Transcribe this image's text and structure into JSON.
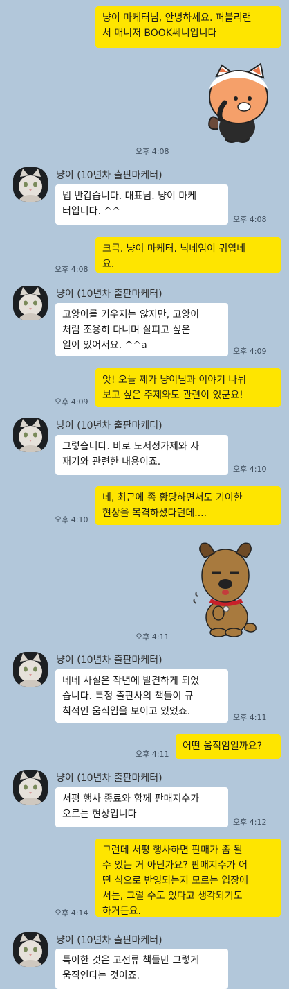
{
  "chat": {
    "sender_name": "냥이 (10년차 출판마케터)",
    "messages": [
      {
        "from": "me",
        "text": "냥이 마케터님, 안녕하세요. 퍼블리랜서 매니저 BOOK쎄니입니다",
        "time": ""
      },
      {
        "from": "me",
        "kind": "sticker",
        "sticker": "cat-sticker",
        "time": "오후 4:08"
      },
      {
        "from": "other",
        "text": "넵 반갑습니다. 대표님. 냥이 마케터입니다. ^^",
        "time": "오후 4:08"
      },
      {
        "from": "me",
        "text": "크큭. 냥이 마케터. 닉네임이 귀엽네요.",
        "time": "오후 4:08"
      },
      {
        "from": "other",
        "text": "고양이를 키우지는 않지만, 고양이처럼 조용히 다니며 살피고 싶은 일이 있어서요. ^^a",
        "time": "오후 4:09"
      },
      {
        "from": "me",
        "text": "앗! 오늘 제가 냥이님과 이야기 나눠보고 싶은 주제와도 관련이 있군요!",
        "time": "오후 4:09"
      },
      {
        "from": "other",
        "text": "그렇습니다. 바로 도서정가제와 사재기와 관련한 내용이죠.",
        "time": "오후 4:10"
      },
      {
        "from": "me",
        "text": "네, 최근에 좀 황당하면서도 기이한 현상을 목격하셨다던데....",
        "time": "오후 4:10"
      },
      {
        "from": "me",
        "kind": "sticker",
        "sticker": "dog-sticker",
        "time": "오후 4:11"
      },
      {
        "from": "other",
        "text": "네네 사실은 작년에 발견하게 되었습니다. 특정 출판사의 책들이 규칙적인 움직임을 보이고 있었죠.",
        "time": "오후 4:11"
      },
      {
        "from": "me",
        "text": "어떤 움직임일까요?",
        "time": "오후 4:11"
      },
      {
        "from": "other",
        "text": "서평 행사 종료와 함께 판매지수가 오르는 현상입니다",
        "time": "오후 4:12"
      },
      {
        "from": "me",
        "text": "그런데 서평 행사하면 판매가 좀 될 수 있는 거 아닌가요? 판매지수가 어떤 식으로 반영되는지 모르는 입장에서는, 그럴 수도 있다고 생각되기도 하거든요.",
        "time": "오후 4:14"
      },
      {
        "from": "other",
        "text": "특이한 것은 고전류 책들만 그렇게 움직인다는 것이죠.",
        "time": ""
      }
    ],
    "lines": {
      "m0": "냥이 마케터님, 안녕하세요. 퍼블리랜\n서 매니저 BOOK쎄니입니다",
      "m2": "넵 반갑습니다. 대표님. 냥이 마케\n터입니다. ^^",
      "m3": "크큭. 냥이 마케터. 닉네임이 귀엽네\n요.",
      "m4": "고양이를 키우지는 않지만, 고양이\n처럼 조용히 다니며 살피고 싶은\n일이 있어서요. ^^a",
      "m5": "앗! 오늘 제가 냥이님과 이야기 나눠\n보고 싶은 주제와도 관련이 있군요!",
      "m6": "그렇습니다. 바로 도서정가제와 사\n재기와 관련한 내용이죠.",
      "m7": "네, 최근에 좀 황당하면서도 기이한\n현상을 목격하셨다던데....",
      "m9": "네네 사실은 작년에 발견하게 되었\n습니다. 특정 출판사의 책들이 규\n칙적인 움직임을 보이고 있었죠.",
      "m10": "어떤 움직임일까요?",
      "m11": "서평 행사 종료와 함께 판매지수가\n오르는 현상입니다",
      "m12": "그런데 서평 행사하면 판매가 좀 될\n수 있는 거 아닌가요? 판매지수가 어\n떤 식으로 반영되는지 모르는 입장에\n서는, 그럴 수도 있다고 생각되기도\n하거든요.",
      "m13": "특이한 것은 고전류 책들만 그렇게\n움직인다는 것이죠."
    }
  },
  "colors": {
    "background": "#b2c7da",
    "my_bubble": "#fee500",
    "their_bubble": "#ffffff"
  },
  "icons": [
    "cat-avatar",
    "cat-sticker",
    "dog-sticker"
  ]
}
